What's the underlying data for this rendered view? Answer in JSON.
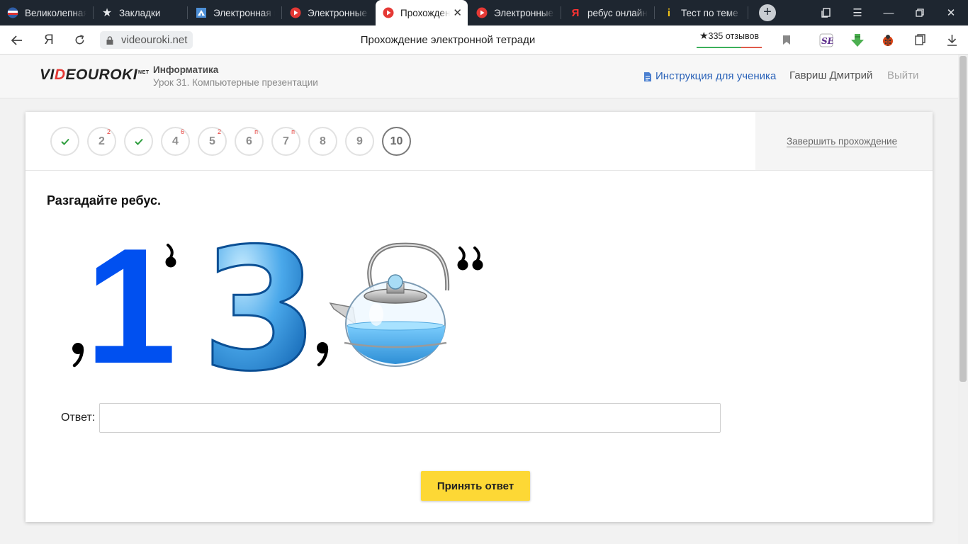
{
  "browser": {
    "tabs": [
      {
        "title": "Великолепная",
        "icon": "globe-icon",
        "active": false
      },
      {
        "title": "Закладки",
        "icon": "star-icon",
        "active": false
      },
      {
        "title": "Электронная ш",
        "icon": "school-icon",
        "active": false
      },
      {
        "title": "Электронные",
        "icon": "videouroki-icon",
        "active": false
      },
      {
        "title": "Прохожден",
        "icon": "videouroki-icon",
        "active": true
      },
      {
        "title": "Электронные",
        "icon": "videouroki-icon",
        "active": false
      },
      {
        "title": "ребус онлайн",
        "icon": "yandex-icon",
        "active": false
      },
      {
        "title": "Тест по теме \"",
        "icon": "info-icon",
        "active": false
      }
    ],
    "url": "videouroki.net",
    "page_title": "Прохождение электронной тетради",
    "reviews": "335 отзывов"
  },
  "header": {
    "logo": {
      "left": "VI",
      "accent": "D",
      "right": "EOUROKI",
      "sup": "NET"
    },
    "subject": "Информатика",
    "lesson": "Урок 31. Компьютерные презентации",
    "instruction_link": "Инструкция для ученика",
    "user_name": "Гавриш Дмитрий",
    "logout": "Выйти"
  },
  "steps": [
    {
      "label": "",
      "done": true,
      "mark": ""
    },
    {
      "label": "2",
      "done": false,
      "mark": "2"
    },
    {
      "label": "",
      "done": true,
      "mark": ""
    },
    {
      "label": "4",
      "done": false,
      "mark": "6"
    },
    {
      "label": "5",
      "done": false,
      "mark": "2"
    },
    {
      "label": "6",
      "done": false,
      "mark": "п"
    },
    {
      "label": "7",
      "done": false,
      "mark": "п"
    },
    {
      "label": "8",
      "done": false,
      "mark": ""
    },
    {
      "label": "9",
      "done": false,
      "mark": ""
    },
    {
      "label": "10",
      "done": false,
      "mark": "",
      "current": true
    }
  ],
  "finish_label": "Завершить прохождение",
  "question": {
    "title": "Разгадайте ребус.",
    "rebus_digit_one": "1",
    "rebus_digit_three": "3",
    "answer_label": "Ответ:",
    "answer_value": "",
    "submit_label": "Принять ответ"
  },
  "colors": {
    "accent_yellow": "#fdd835",
    "link_blue": "#2a62b8",
    "logo_red": "#e53935",
    "check_green": "#2e9e3e",
    "rebus_blue": "#0050f0"
  }
}
